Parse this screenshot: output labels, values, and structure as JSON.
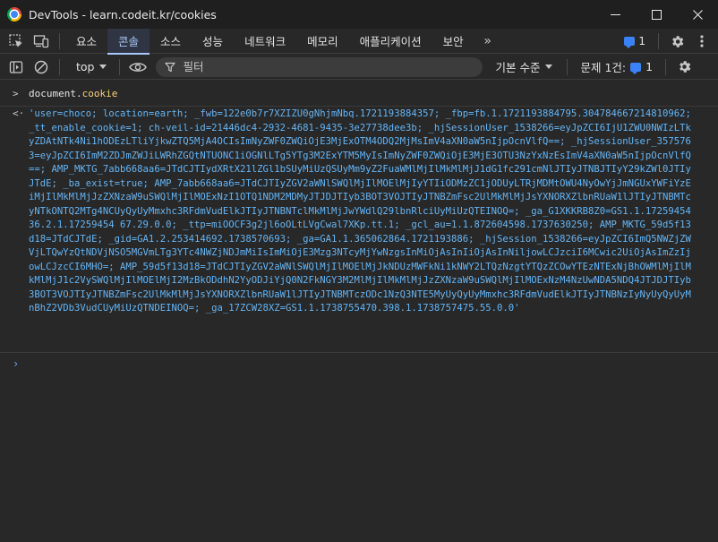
{
  "window": {
    "title": "DevTools - learn.codeit.kr/cookies",
    "controls": {
      "minimize": "—",
      "maximize": "☐",
      "close": "✕"
    }
  },
  "tabs": [
    {
      "label": "요소",
      "active": false
    },
    {
      "label": "콘솔",
      "active": true
    },
    {
      "label": "소스",
      "active": false
    },
    {
      "label": "성능",
      "active": false
    },
    {
      "label": "네트워크",
      "active": false
    },
    {
      "label": "메모리",
      "active": false
    },
    {
      "label": "애플리케이션",
      "active": false
    },
    {
      "label": "보안",
      "active": false
    }
  ],
  "tabs_more": "»",
  "messages_count": "1",
  "toolbar": {
    "context": "top",
    "filter_placeholder": "필터",
    "levels": "기본 수준",
    "issues_label": "문제 1건:",
    "issues_count": "1"
  },
  "console": {
    "input_prefix": "document.",
    "input_prop": "cookie",
    "output": "'user=choco; location=earth; _fwb=122e0b7r7XZIZU0gNhjmNbq.1721193884357; _fbp=fb.1.1721193884795.304784667214810962; _tt_enable_cookie=1; ch-veil-id=21446dc4-2932-4681-9435-3e27738dee3b; _hjSessionUser_1538266=eyJpZCI6IjU1ZWU0NWIzLTkyZDAtNTk4Ni1hODEzLTliYjkwZTQ5MjA4OCIsImNyZWF0ZWQiOjE3MjExOTM4ODQ2MjMsImV4aXN0aW5nIjpOcnVlfQ==; _hjSessionUser_3575763=eyJpZCI6ImM2ZDJmZWJiLWRhZGQtNTUONC1iOGNlLTg5YTg3M2ExYTM5MyIsImNyZWF0ZWQiOjE3MjE3OTU3NzYxNzEsImV4aXN0aW5nIjpOcnVlfQ==; AMP_MKTG_7abb668aa6=JTdCJTIydXRtX21lZGl1bSUyMiUzQSUyMm9yZ2FuaWMlMjIlMkMlMjJ1dG1fc291cmNlJTIyJTNBJTIyY29kZWl0JTIyJTdE; _ba_exist=true; AMP_7abb668aa6=JTdCJTIyZGV2aWNlSWQlMjIlMOElMjIyYTIiODMzZC1jODUyLTRjMDMtOWU4NyOwYjJmNGUxYWFiYzEiMjIlMkMlMjJzZXNzaW9uSWQlMjIlMOExNzI1OTQ1NDM2MDMyJTJDJTIyb3BOT3VOJTIyJTNBZmFsc2UlMkMlMjJsYXNORXZlbnRUaW1lJTIyJTNBMTcyNTkONTQ2MTg4NCUyQyUyMmxhc3RFdmVudElkJTIyJTNBNTclMkMlMjJwYWdlQ29lbnRlciUyMiUzQTEINOQ=; _ga_G1XKKRB8Z0=GS1.1.1725945436.2.1.17259454 67.29.0.0; _ttp=miOOCF3g2jl6oOLtLVgCwal7XKp.tt.1; _gcl_au=1.1.872604598.1737630250; AMP_MKTG_59d5f13d18=JTdCJTdE; _gid=GA1.2.253414692.1738570693; _ga=GA1.1.365062864.1721193886; _hjSession_1538266=eyJpZCI6ImQ5NWZjZWVjLTQwYzQtNDVjNSO5MGVmLTg3YTc4NWZjNDJmMiIsImMiOjE3Mzg3NTcyMjYwNzgsInMiOjAsInIiOjAsInNiljowLCJzciI6MCwic2UiOjAsImZzIjowLCJzcCI6MHO=; AMP_59d5f13d18=JTdCJTIyZGV2aWNlSWQlMjIlMOElMjJkNDUzMWFkNi1kNWY2LTQzNzgtYTQzZCOwYTEzNTExNjBhOWMlMjIlMkMlMjJ1c2VySWQlMjIlMOElMjI2MzBkODdhN2YyODJiYjQ0N2FkNGY3M2MlMjIlMkMlMjJzZXNzaW9uSWQlMjIlMOExNzM4NzUwNDA5NDQ4JTJDJTIyb3BOT3VOJTIyJTNBZmFsc2UlMkMlMjJsYXNORXZlbnRUaW1lJTIyJTNBMTczODc1NzQ3NTE5MyUyQyUyMmxhc3RFdmVudElkJTIyJTNBNzIyNyUyQyUyMnBhZ2VDb3VudCUyMiUzQTNDEINOQ=; _ga_17ZCW28XZ=GS1.1.1738755470.398.1.1738757475.55.0.0'"
  }
}
